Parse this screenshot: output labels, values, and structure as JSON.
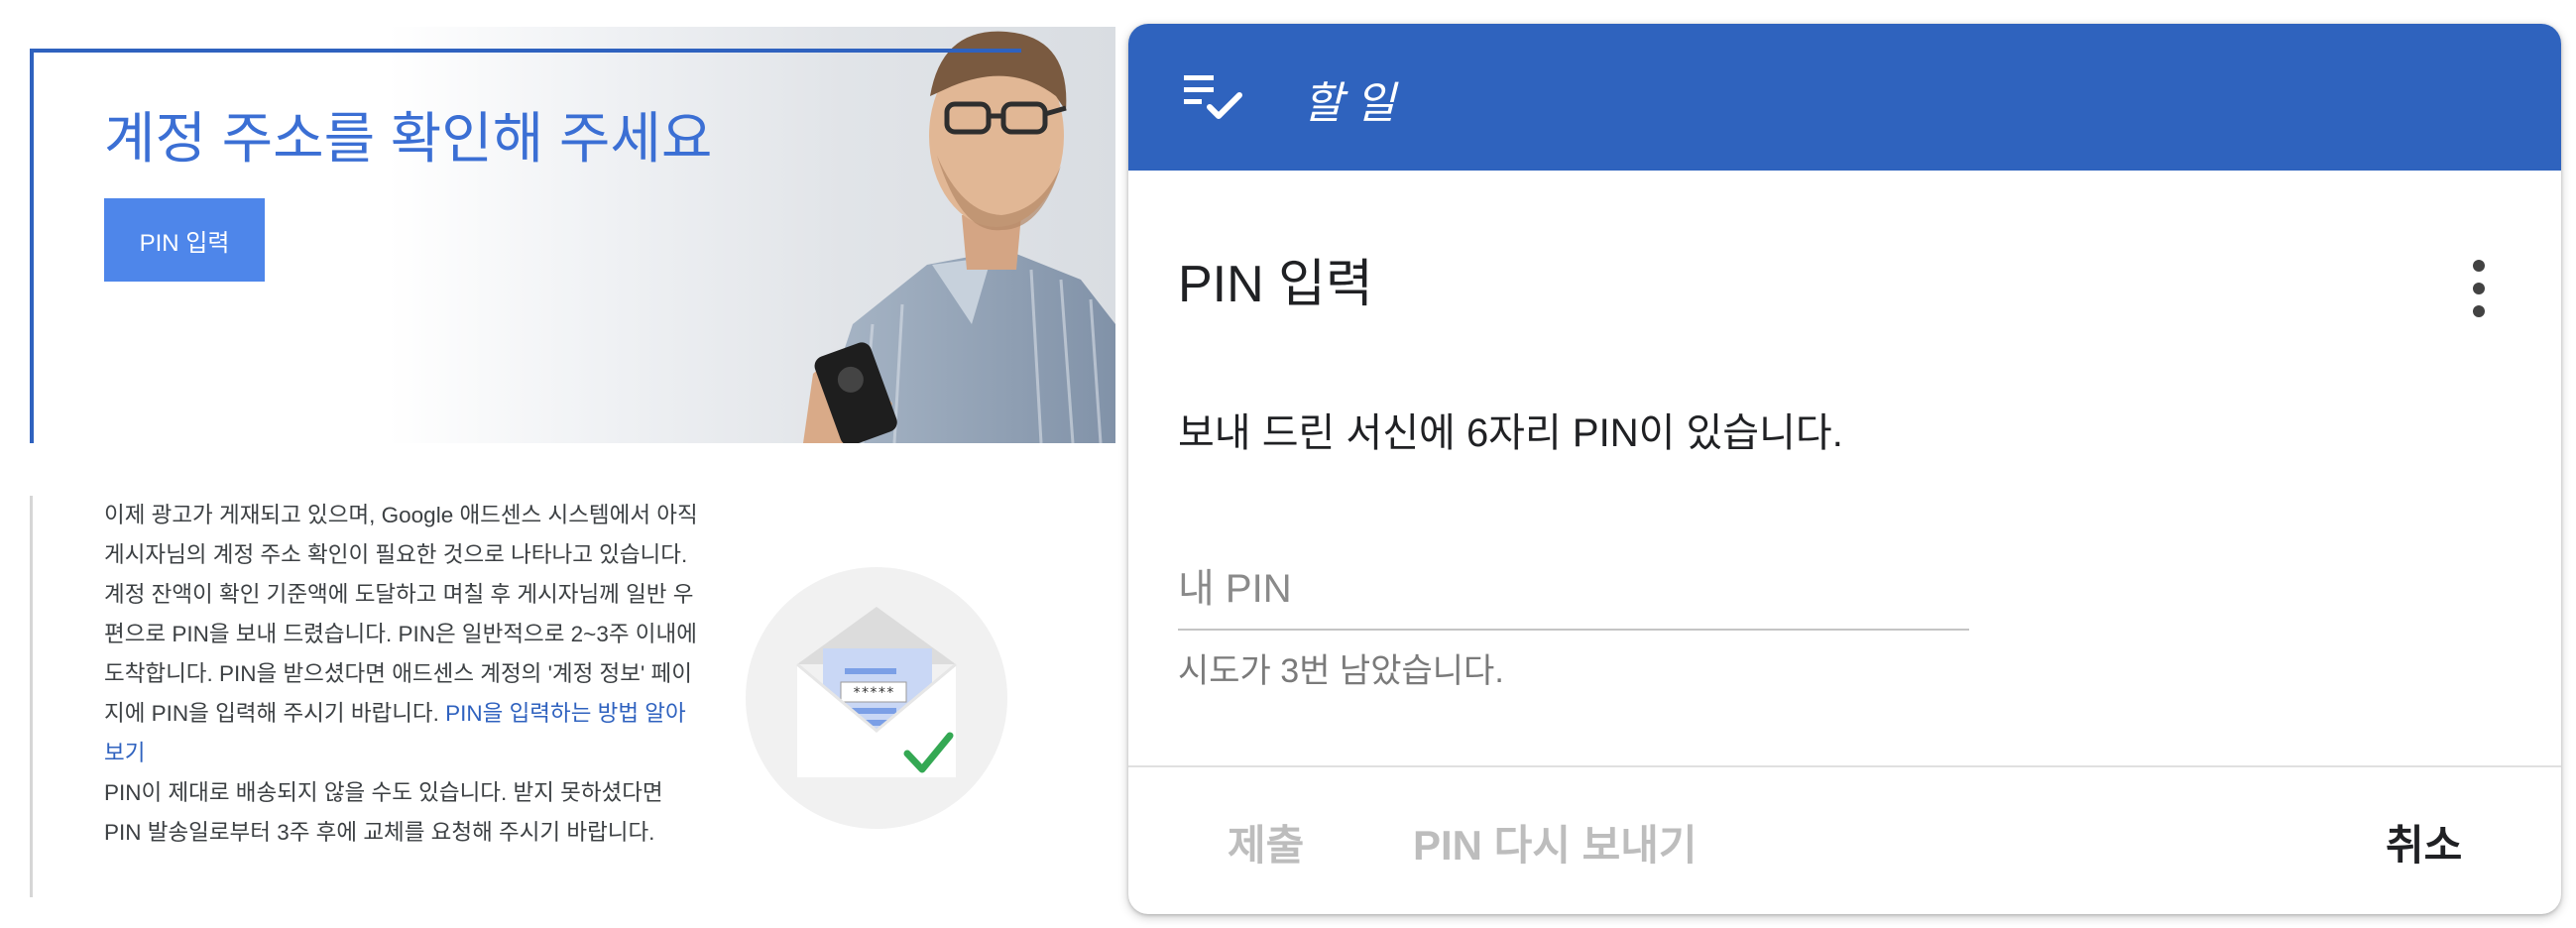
{
  "hero": {
    "title": "계정 주소를 확인해 주세요",
    "button_label": "PIN 입력"
  },
  "body": {
    "paragraph1": "이제 광고가 게재되고 있으며, Google 애드센스 시스템에서 아직 게시자님의 계정 주소 확인이 필요한 것으로 나타나고 있습니다.",
    "paragraph2": "계정 잔액이 확인 기준액에 도달하고 며칠 후 게시자님께 일반 우편으로 PIN을 보내 드렸습니다. PIN은 일반적으로 2~3주 이내에 도착합니다. PIN을 받으셨다면 애드센스 계정의 '계정 정보' 페이지에 PIN을 입력해 주시기 바랍니다.",
    "link": "PIN을 입력하는 방법 알아보기",
    "paragraph3": "PIN이 제대로 배송되지 않을 수도 있습니다. 받지 못하셨다면 PIN 발송일로부터 3주 후에 교체를 요청해 주시기 바랍니다.",
    "envelope_mask": "*****"
  },
  "dialog": {
    "header_title": "할 일",
    "title": "PIN 입력",
    "message": "보내 드린 서신에 6자리 PIN이 있습니다.",
    "input_placeholder": "내 PIN",
    "input_value": "",
    "helper_text": "시도가 3번 남았습니다.",
    "actions": {
      "submit": "제출",
      "resend": "PIN 다시 보내기",
      "cancel": "취소"
    }
  },
  "icons": {
    "header": "tasks-checklist-icon",
    "menu": "more-vert-icon",
    "illustration": "envelope-check-icon"
  },
  "colors": {
    "brand_blue": "#2f63be",
    "hero_title": "#3b6fd4",
    "hero_button": "#4e86ea",
    "link": "#2f62bf",
    "check_green": "#34a853",
    "disabled_text": "#bdbdbd"
  }
}
